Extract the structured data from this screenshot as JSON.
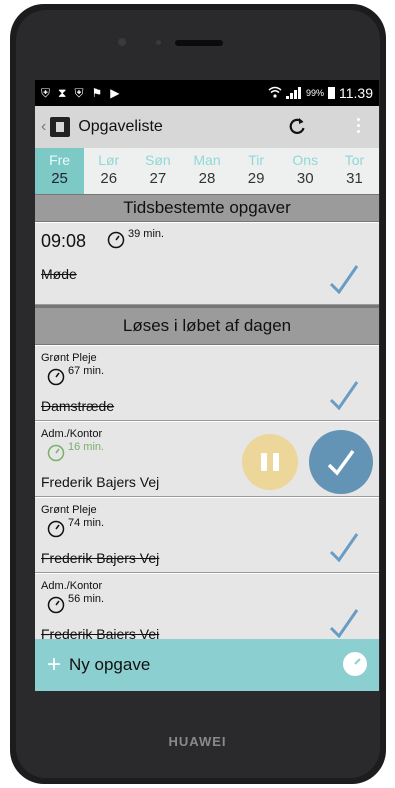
{
  "device": {
    "brand": "HUAWEI"
  },
  "status_bar": {
    "battery_pct": "99%",
    "time": "11.39",
    "icons": [
      "shield-icon",
      "pin-icon",
      "shield-icon",
      "flag-icon",
      "play-icon"
    ]
  },
  "action_bar": {
    "back": "‹",
    "title": "Opgaveliste"
  },
  "days": [
    {
      "name": "Fre",
      "date": "25",
      "active": true
    },
    {
      "name": "Lør",
      "date": "26"
    },
    {
      "name": "Søn",
      "date": "27"
    },
    {
      "name": "Man",
      "date": "28"
    },
    {
      "name": "Tir",
      "date": "29"
    },
    {
      "name": "Ons",
      "date": "30"
    },
    {
      "name": "Tor",
      "date": "31"
    }
  ],
  "sections": {
    "timed": "Tidsbestemte opgaver",
    "daytime": "Løses i løbet af dagen"
  },
  "timed_task": {
    "time": "09:08",
    "duration": "39 min.",
    "name": "Møde"
  },
  "tasks": [
    {
      "category": "Grønt Pleje",
      "duration": "67 min.",
      "name": "Damstræde"
    },
    {
      "category": "Adm./Kontor",
      "duration": "16 min.",
      "name": "Frederik Bajers Vej"
    },
    {
      "category": "Grønt Pleje",
      "duration": "74 min.",
      "name": "Frederik Bajers Vej"
    },
    {
      "category": "Adm./Kontor",
      "duration": "56 min.",
      "name": "Frederik Bajers Vej"
    }
  ],
  "bottom": {
    "plus": "+",
    "new_task": "Ny opgave"
  },
  "colors": {
    "accent": "#7cc9c6",
    "check": "#6a9cc4",
    "pause": "#ecd69a",
    "done": "#6494b5",
    "active_duration": "#78b06c"
  }
}
